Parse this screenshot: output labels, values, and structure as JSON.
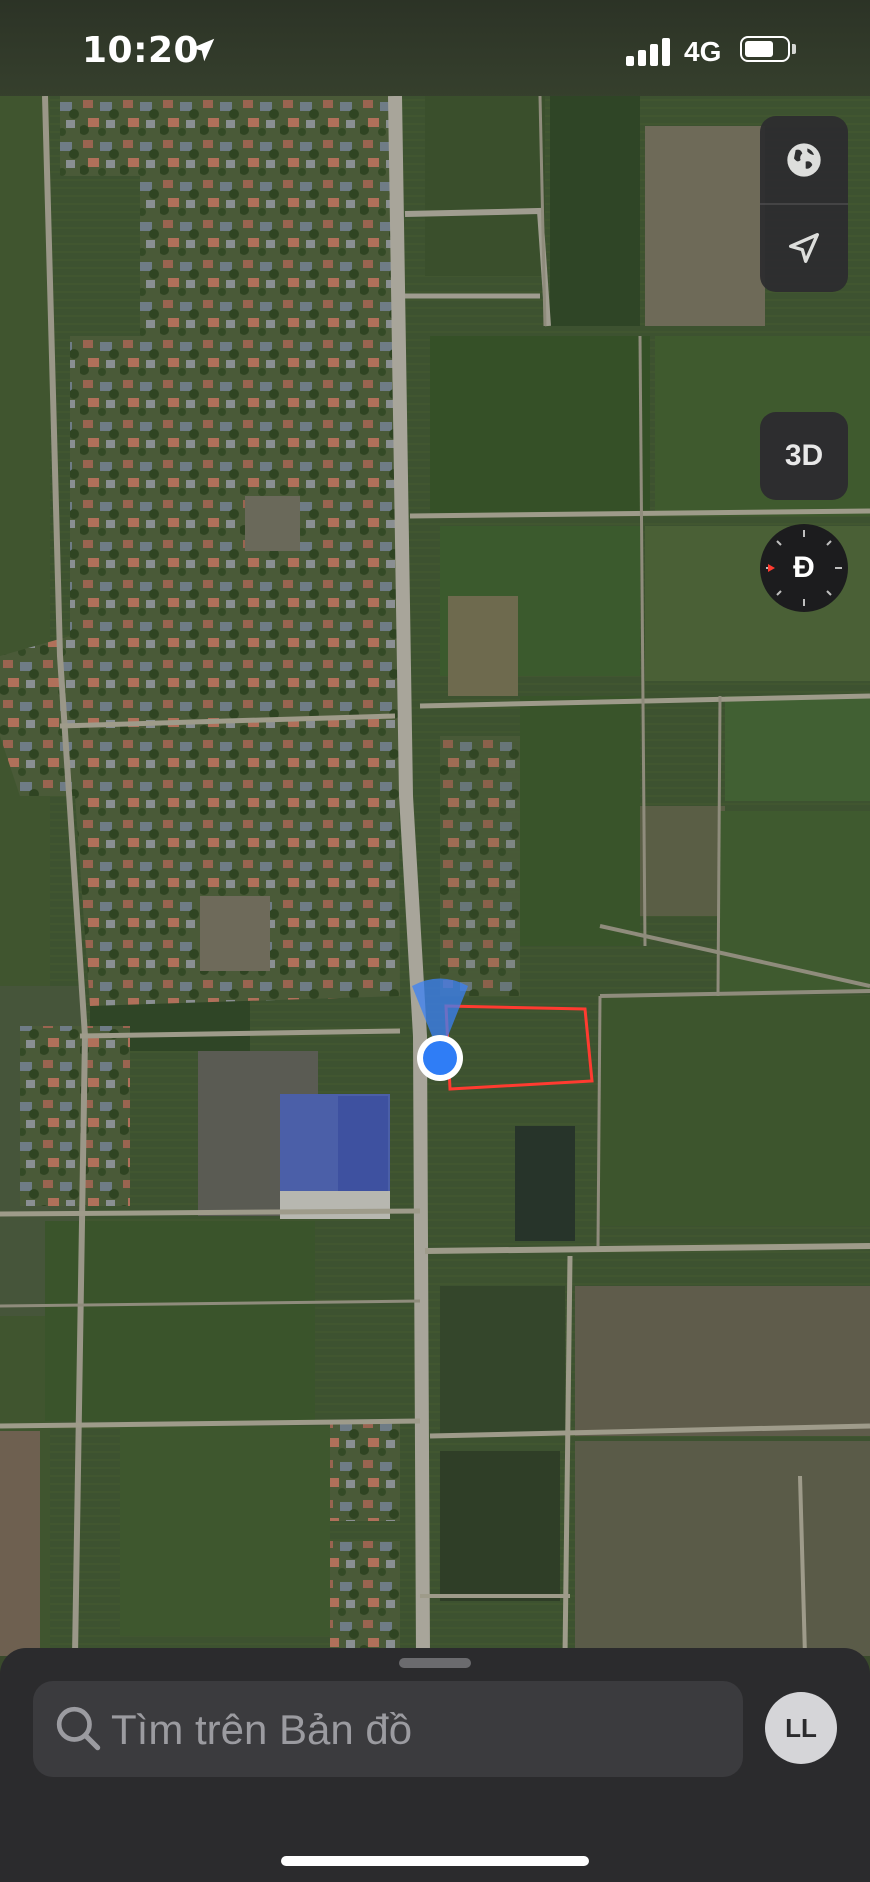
{
  "status_bar": {
    "time": "10:20",
    "network": "4G",
    "battery_level": 0.6,
    "signal_bars": 4
  },
  "map": {
    "view": "satellite",
    "controls": {
      "map_mode_icon": "globe-icon",
      "locate_icon": "location-arrow-icon",
      "three_d_label": "3D",
      "compass_label": "Đ"
    }
  },
  "search": {
    "placeholder": "Tìm trên Bản đồ"
  },
  "account": {
    "initials": "LL"
  },
  "colors": {
    "accent": "#3b82f6",
    "boundary": "#ff3b30"
  }
}
